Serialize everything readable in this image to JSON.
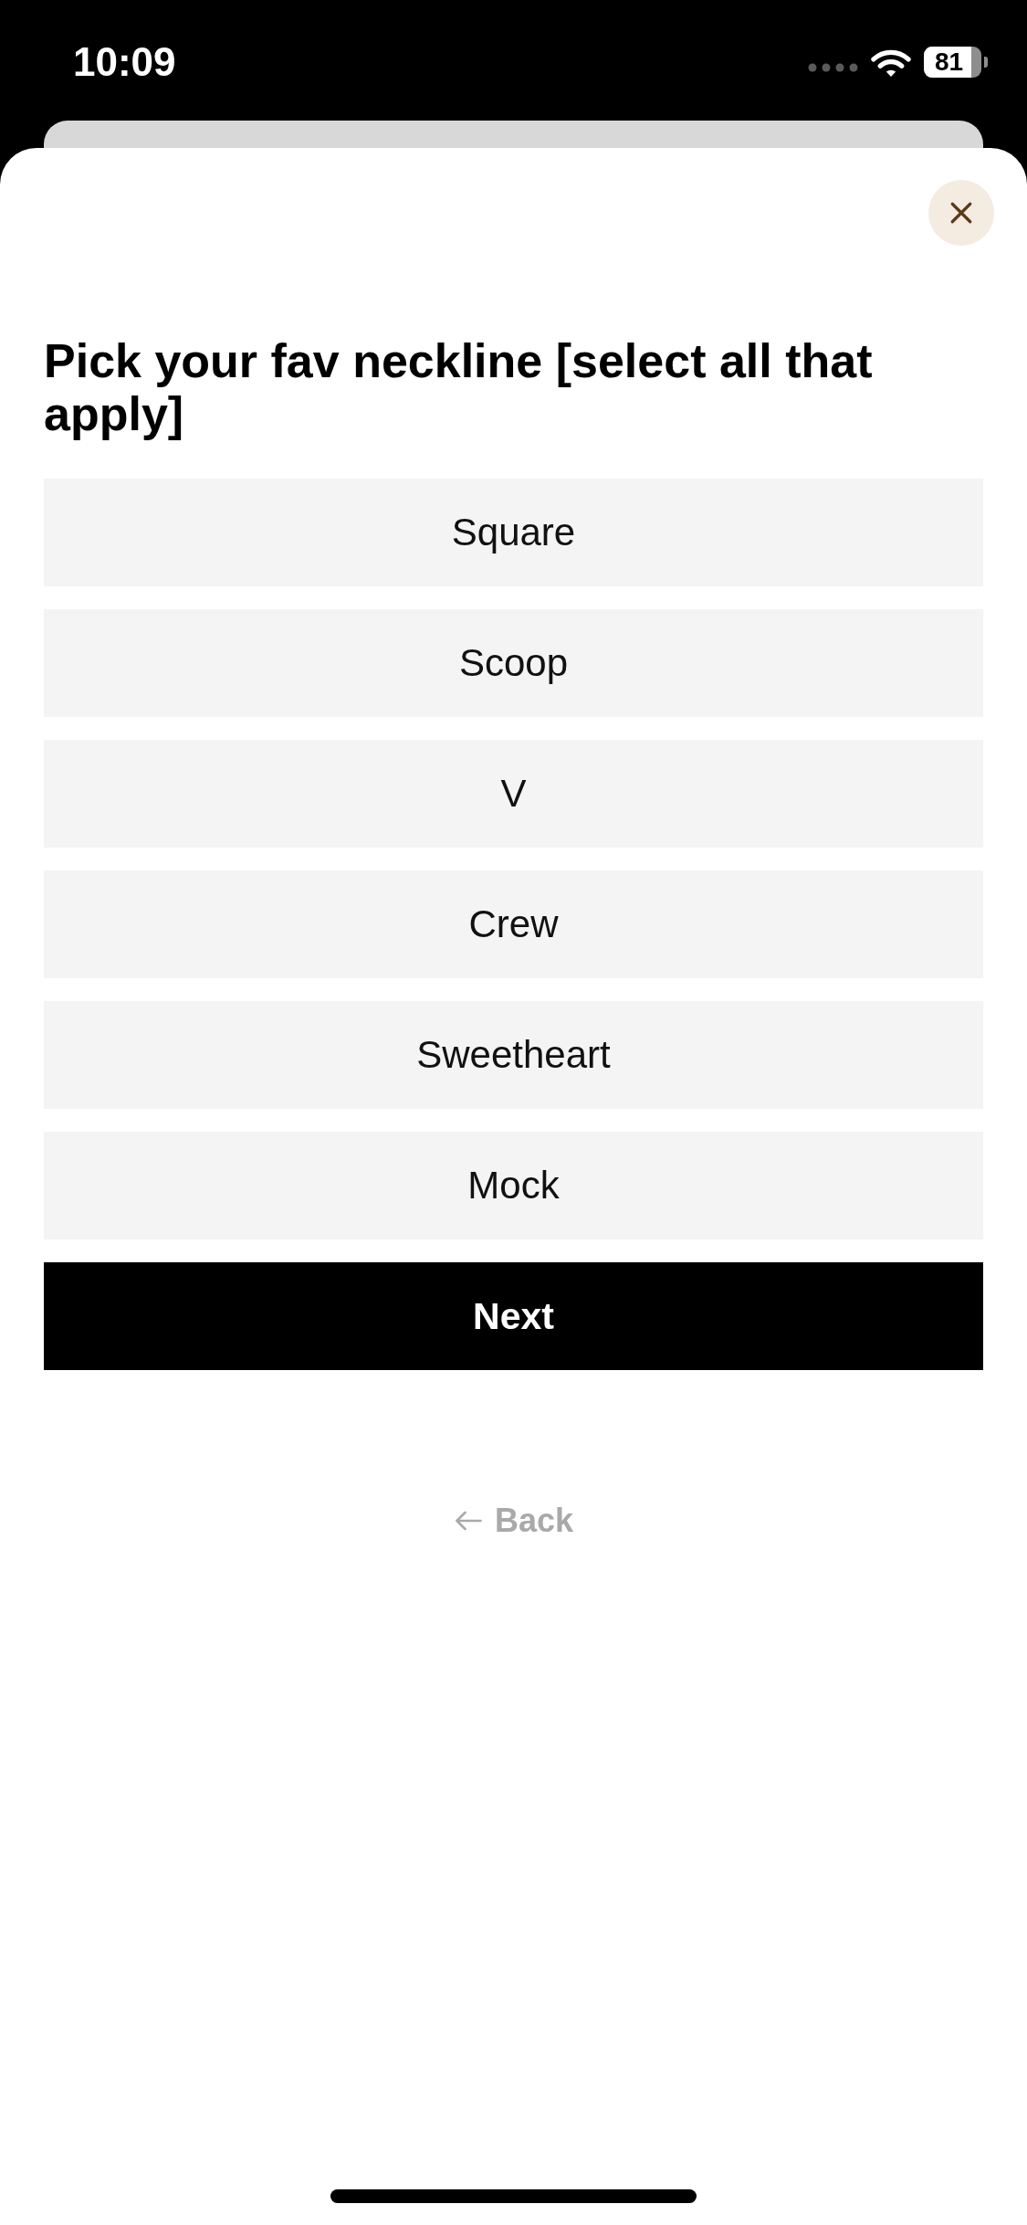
{
  "status_bar": {
    "time": "10:09",
    "battery": "81"
  },
  "question": {
    "title": "Pick your fav neckline [select all that apply]"
  },
  "options": [
    {
      "label": "Square",
      "selected": false
    },
    {
      "label": "Scoop",
      "selected": false
    },
    {
      "label": "V",
      "selected": false
    },
    {
      "label": "Crew",
      "selected": false
    },
    {
      "label": "Sweetheart",
      "selected": false
    },
    {
      "label": "Mock",
      "selected": false
    }
  ],
  "next_button": {
    "label": "Next"
  },
  "back_button": {
    "label": "Back"
  }
}
